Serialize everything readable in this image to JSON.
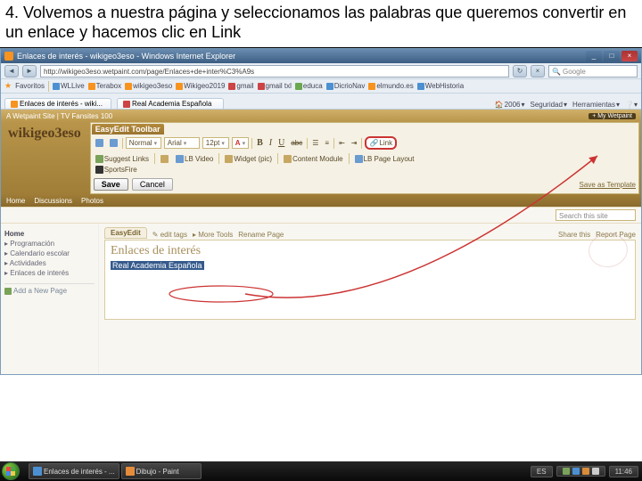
{
  "instruction": "4. Volvemos a nuestra página y seleccionamos las palabras que queremos convertir en un enlace y hacemos clic en Link",
  "browser": {
    "title": "Enlaces de interés - wikigeo3eso - Windows Internet Explorer",
    "address": "http://wikigeo3eso.wetpaint.com/page/Enlaces+de+inter%C3%A9s",
    "search_placeholder": "Google"
  },
  "favorites": {
    "label": "Favoritos",
    "items": [
      "WLLive",
      "Terabox",
      "wikigeo3eso",
      "Wikigeo2019",
      "gmail",
      "gmail txl",
      "educa",
      "DicrioNav",
      "elmundo.es",
      "WebHistoria"
    ]
  },
  "tabs": {
    "tab1": "Enlaces de interés - wiki...",
    "tab2": "Real Academia Española",
    "tools": {
      "home": "2006",
      "security": "Seguridad",
      "tools_menu": "Herramientas"
    }
  },
  "site": {
    "banner_left": "A Wetpaint Site | TV Fansites 100",
    "banner_right": "+ My Wetpaint",
    "title": "wikigeo3eso",
    "nav": [
      "Home",
      "Discussions",
      "Photos"
    ],
    "search_placeholder": "Search this site"
  },
  "editToolbar": {
    "title": "EasyEdit Toolbar",
    "style": "Normal",
    "font": "Arial",
    "size": "12pt",
    "color_label": "A",
    "link_label": "Link",
    "row2": {
      "suggest": "Suggest Links",
      "video": "LB Video",
      "widget": "Widget (pic)",
      "content_module": "Content Module",
      "page_layout": "LB Page Layout",
      "sportsfire": "SportsFire"
    },
    "save": "Save",
    "cancel": "Cancel",
    "save_template": "Save as Template"
  },
  "sidebar": {
    "items": [
      "Home",
      "Programación",
      "Calendario escolar",
      "Actividades",
      "Enlaces de interés"
    ],
    "add_page": "Add a New Page"
  },
  "pageTabs": {
    "easyedit": "EasyEdit",
    "edit_tags": "edit tags",
    "more_tools": "More Tools",
    "rename": "Rename Page",
    "share": "Share this",
    "report": "Report Page"
  },
  "page": {
    "heading": "Enlaces de interés",
    "selected_text": "Real Academia Española"
  },
  "taskbar": {
    "items": [
      {
        "ico": "b",
        "label": "Enlaces de interés - ..."
      },
      {
        "ico": "o",
        "label": "Dibujo - Paint"
      }
    ],
    "rec": "",
    "lang": "ES",
    "time": "11:46"
  }
}
